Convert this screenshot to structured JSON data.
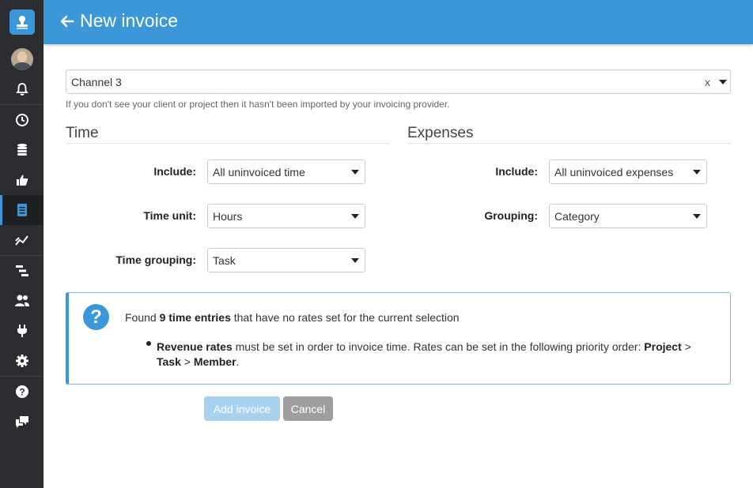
{
  "header": {
    "title": "New invoice"
  },
  "sidebar": {
    "items": [
      {
        "name": "notifications",
        "icon": "bell-icon"
      },
      {
        "name": "time",
        "icon": "clock-icon"
      },
      {
        "name": "budgets",
        "icon": "coins-icon"
      },
      {
        "name": "approvals",
        "icon": "thumbs-up-icon"
      },
      {
        "name": "invoices",
        "icon": "invoice-icon",
        "active": true
      },
      {
        "name": "reports",
        "icon": "chart-icon"
      },
      {
        "name": "planning",
        "icon": "timeline-icon"
      },
      {
        "name": "team",
        "icon": "users-icon"
      },
      {
        "name": "integrations",
        "icon": "plug-icon"
      },
      {
        "name": "settings",
        "icon": "gear-icon"
      },
      {
        "name": "help",
        "icon": "question-icon"
      },
      {
        "name": "feedback",
        "icon": "chat-icon"
      }
    ]
  },
  "client": {
    "selected": "Channel 3",
    "clear_label": "x",
    "hint": "If you don't see your client or project then it hasn't been imported by your invoicing provider."
  },
  "time": {
    "title": "Time",
    "include_label": "Include:",
    "include_value": "All uninvoiced time",
    "unit_label": "Time unit:",
    "unit_value": "Hours",
    "grouping_label": "Time grouping:",
    "grouping_value": "Task"
  },
  "expenses": {
    "title": "Expenses",
    "include_label": "Include:",
    "include_value": "All uninvoiced expenses",
    "grouping_label": "Grouping:",
    "grouping_value": "Category"
  },
  "info": {
    "icon_glyph": "?",
    "line1_pre": "Found ",
    "line1_bold": "9 time entries",
    "line1_post": " that have no rates set for the current selection",
    "line2_bold1": "Revenue rates",
    "line2_text": " must be set in order to invoice time. Rates can be set in the following priority order: ",
    "line2_bold2": "Project",
    "line2_sep1": " > ",
    "line2_bold3": "Task",
    "line2_sep2": " > ",
    "line2_bold4": "Member",
    "line2_end": "."
  },
  "actions": {
    "add_label": "Add invoice",
    "cancel_label": "Cancel"
  },
  "colors": {
    "accent": "#3c97d8",
    "sidebar": "#2b2d30",
    "add_disabled": "#a7d1ef",
    "cancel": "#9e9e9e"
  }
}
